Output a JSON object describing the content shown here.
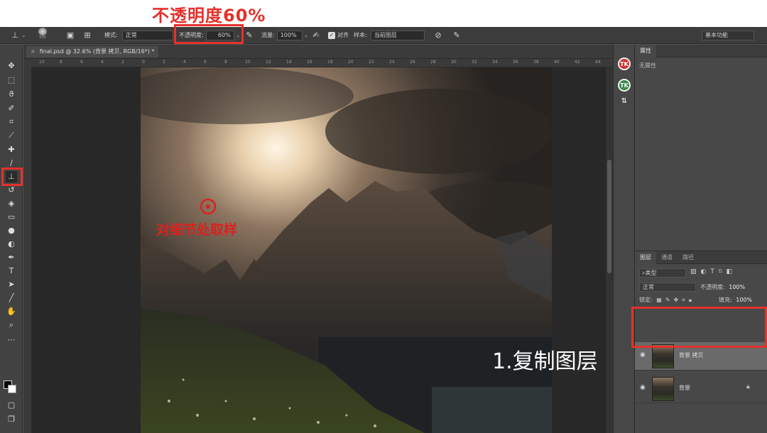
{
  "annotations": {
    "top_title": "不透明度60%",
    "sample_hint": "对细节处取样",
    "step_1": "1.复制图层"
  },
  "options_bar": {
    "mode_label": "模式:",
    "mode_value": "正常",
    "opacity_label": "不透明度:",
    "opacity_value": "60%",
    "flow_label": "流量:",
    "flow_value": "100%",
    "aligned_label": "对齐",
    "sample_label": "样本:",
    "sample_value": "当前图层",
    "brush_size": "500",
    "workspace": "基本功能"
  },
  "document": {
    "tab_title": "final.psd @ 32.6% (背景 拷贝, RGB/16*) *"
  },
  "rulers": {
    "h_ticks": [
      "10",
      "8",
      "6",
      "4",
      "2",
      "0",
      "2",
      "4",
      "6",
      "8",
      "10",
      "12",
      "14",
      "16",
      "18",
      "20",
      "22",
      "24",
      "26",
      "28",
      "30",
      "32",
      "34",
      "36",
      "38",
      "40",
      "42",
      "44"
    ]
  },
  "properties_panel": {
    "tab": "属性",
    "empty_text": "无属性"
  },
  "layers_panel": {
    "tabs": [
      "图层",
      "通道",
      "路径"
    ],
    "filter_kind": "类型",
    "blend_mode": "正常",
    "opacity_label": "不透明度:",
    "opacity_value": "100%",
    "lock_label": "锁定:",
    "fill_label": "填充:",
    "fill_value": "100%",
    "layers": [
      {
        "name": "背景 拷贝",
        "selected": true
      },
      {
        "name": "背景",
        "selected": false
      }
    ]
  },
  "panel_icons": {
    "tk1": "TK",
    "tk2": "TK"
  },
  "colors": {
    "annotation_red": "#e5312b",
    "app_bg": "#535353",
    "panel_bg": "#484848"
  }
}
